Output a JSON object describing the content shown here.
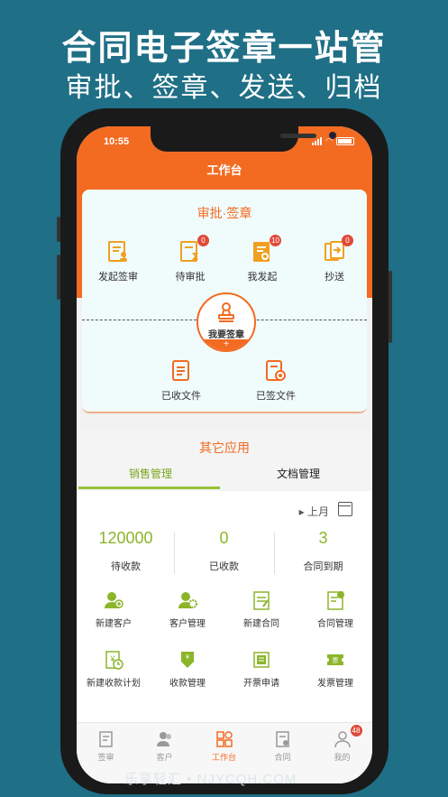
{
  "hero": {
    "title": "合同电子签章一站管",
    "subtitle": "审批、签章、发送、归档"
  },
  "status": {
    "time": "10:55"
  },
  "nav": {
    "title": "工作台"
  },
  "approval": {
    "title": "审批·签章",
    "tiles": [
      {
        "label": "发起签审",
        "icon": "initiate-sign-icon",
        "badge": ""
      },
      {
        "label": "待审批",
        "icon": "pending-approval-icon",
        "badge": "0"
      },
      {
        "label": "我发起",
        "icon": "my-initiated-icon",
        "badge": "10"
      },
      {
        "label": "抄送",
        "icon": "cc-icon",
        "badge": "0"
      }
    ],
    "stamp": {
      "label": "我要签章",
      "plus": "+"
    },
    "files": [
      {
        "label": "已收文件",
        "icon": "received-file-icon"
      },
      {
        "label": "已签文件",
        "icon": "signed-file-icon"
      }
    ]
  },
  "other": {
    "title": "其它应用",
    "tabs": [
      {
        "label": "销售管理"
      },
      {
        "label": "文档管理"
      }
    ],
    "month": "上月",
    "stats": [
      {
        "value": "120000",
        "label": "待收款"
      },
      {
        "value": "0",
        "label": "已收款"
      },
      {
        "value": "3",
        "label": "合同到期"
      }
    ],
    "apps": [
      {
        "label": "新建客户",
        "icon": "new-customer-icon"
      },
      {
        "label": "客户管理",
        "icon": "customer-manage-icon"
      },
      {
        "label": "新建合同",
        "icon": "new-contract-icon"
      },
      {
        "label": "合同管理",
        "icon": "contract-manage-icon"
      },
      {
        "label": "新建收款计划",
        "icon": "payment-plan-icon"
      },
      {
        "label": "收款管理",
        "icon": "collection-manage-icon"
      },
      {
        "label": "开票申请",
        "icon": "invoice-apply-icon"
      },
      {
        "label": "发票管理",
        "icon": "invoice-manage-icon"
      }
    ]
  },
  "tabbar": [
    {
      "label": "签审",
      "icon": "sign-review-icon"
    },
    {
      "label": "客户",
      "icon": "customers-icon"
    },
    {
      "label": "工作台",
      "icon": "workbench-icon"
    },
    {
      "label": "合同",
      "icon": "contract-icon"
    },
    {
      "label": "我的",
      "icon": "profile-icon",
      "badge": "48"
    }
  ],
  "watermark": "乐享轻汇 • NJYCQH.COM",
  "colors": {
    "brand": "#f26b21",
    "accent_green": "#8cb52a",
    "background": "#1f6f86"
  }
}
